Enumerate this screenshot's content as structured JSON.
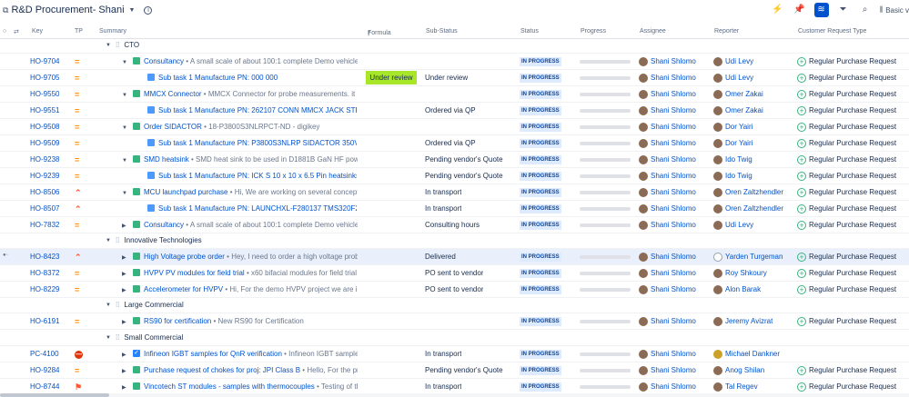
{
  "header": {
    "title": "R&D Procurement- Shani",
    "basic_view": "Basic v"
  },
  "columns": {
    "key": "Key",
    "tp": "TP",
    "summary": "Summary",
    "formula": "Formula",
    "substatus": "Sub-Status",
    "status": "Status",
    "progress": "Progress",
    "assignee": "Assignee",
    "reporter": "Reporter",
    "crt": "Customer Request Type"
  },
  "groups": {
    "cto": "CTO",
    "innovative": "Innovative Technologies",
    "large": "Large Commercial",
    "small": "Small Commercial"
  },
  "rows": [
    {
      "key": "HO-9704",
      "summary": "Consultancy",
      "desc": "A small scale of about 100:1 complete Demo vehicle el",
      "formula": "",
      "substatus": "",
      "status": "IN PROGRESS",
      "assignee": "Shani Shlomo",
      "reporter": "Udi Levy",
      "crt": "Regular Purchase Request"
    },
    {
      "key": "HO-9705",
      "summary": "Sub task 1 Manufacture PN: 000 000",
      "desc": "",
      "formula": "Under review",
      "substatus": "Under review",
      "status": "IN PROGRESS",
      "assignee": "Shani Shlomo",
      "reporter": "Udi Levy",
      "crt": "Regular Purchase Request"
    },
    {
      "key": "HO-9550",
      "summary": "MMCX Connector",
      "desc": "MMCX Connector for probe measurements. it ha",
      "formula": "",
      "substatus": "",
      "status": "IN PROGRESS",
      "assignee": "Shani Shlomo",
      "reporter": "Omer Zakai",
      "crt": "Regular Purchase Request"
    },
    {
      "key": "HO-9551",
      "summary": "Sub task 1 Manufacture PN: 262107 CONN MMCX JACK STR 50O",
      "desc": "",
      "formula": "",
      "substatus": "Ordered via QP",
      "status": "IN PROGRESS",
      "assignee": "Shani Shlomo",
      "reporter": "Omer Zakai",
      "crt": "Regular Purchase Request"
    },
    {
      "key": "HO-9508",
      "summary": "Order SIDACTOR",
      "desc": "18-P3800S3NLRPCT-ND - digikey",
      "formula": "",
      "substatus": "",
      "status": "IN PROGRESS",
      "assignee": "Shani Shlomo",
      "reporter": "Dor Yairi",
      "crt": "Regular Purchase Request"
    },
    {
      "key": "HO-9509",
      "summary": "Sub task 1 Manufacture PN: P3800S3NLRP SIDACTOR 350V 3000",
      "desc": "",
      "formula": "",
      "substatus": "Ordered via QP",
      "status": "IN PROGRESS",
      "assignee": "Shani Shlomo",
      "reporter": "Dor Yairi",
      "crt": "Regular Purchase Request"
    },
    {
      "key": "HO-9238",
      "summary": "SMD heatsink",
      "desc": "SMD heat sink to be used in D1881B GaN HF power s",
      "formula": "",
      "substatus": "Pending vendor's Quote",
      "status": "IN PROGRESS",
      "assignee": "Shani Shlomo",
      "reporter": "Ido Twig",
      "crt": "Regular Purchase Request"
    },
    {
      "key": "HO-9239",
      "summary": "Sub task 1 Manufacture PN: ICK S 10 x 10 x 6.5 Pin heatsinks rect",
      "desc": "",
      "formula": "",
      "substatus": "Pending vendor's Quote",
      "status": "IN PROGRESS",
      "assignee": "Shani Shlomo",
      "reporter": "Ido Twig",
      "crt": "Regular Purchase Request"
    },
    {
      "key": "HO-8506",
      "summary": "MCU launchpad purchase",
      "desc": "Hi, We are working on several concept de",
      "formula": "",
      "substatus": "In transport",
      "status": "IN PROGRESS",
      "assignee": "Shani Shlomo",
      "reporter": "Oren Zaltzhendler",
      "crt": "Regular Purchase Request"
    },
    {
      "key": "HO-8507",
      "summary": "Sub task 1 Manufacture PN: LAUNCHXL-F280137 TMS320F280",
      "desc": "",
      "formula": "",
      "substatus": "In transport",
      "status": "IN PROGRESS",
      "assignee": "Shani Shlomo",
      "reporter": "Oren Zaltzhendler",
      "crt": "Regular Purchase Request"
    },
    {
      "key": "HO-7832",
      "summary": "Consultancy",
      "desc": "A small scale of about 100:1 complete Demo vehicle el",
      "formula": "",
      "substatus": "Consulting hours",
      "status": "IN PROGRESS",
      "assignee": "Shani Shlomo",
      "reporter": "Udi Levy",
      "crt": "Regular Purchase Request"
    },
    {
      "key": "HO-8423",
      "summary": "High Voltage probe order",
      "desc": "Hey, I need to order a high voltage probe",
      "formula": "",
      "substatus": "Delivered",
      "status": "IN PROGRESS",
      "assignee": "Shani Shlomo",
      "reporter": "Yarden Turgeman",
      "crt": "Regular Purchase Request"
    },
    {
      "key": "HO-8372",
      "summary": "HVPV PV modules for field trial",
      "desc": "x60 bifacial modules for field trial to",
      "formula": "",
      "substatus": "PO sent to vendor",
      "status": "IN PROGRESS",
      "assignee": "Shani Shlomo",
      "reporter": "Roy Shkoury",
      "crt": "Regular Purchase Request"
    },
    {
      "key": "HO-8229",
      "summary": "Accelerometer for HVPV",
      "desc": "Hi, For the demo HVPV project we are inte",
      "formula": "",
      "substatus": "PO sent to vendor",
      "status": "IN PROGRESS",
      "assignee": "Shani Shlomo",
      "reporter": "Alon Barak",
      "crt": "Regular Purchase Request"
    },
    {
      "key": "HO-6191",
      "summary": "RS90 for certification",
      "desc": "New RS90 for Certification",
      "formula": "",
      "substatus": "",
      "status": "IN PROGRESS",
      "assignee": "Shani Shlomo",
      "reporter": "Jeremy Avizrat",
      "crt": "Regular Purchase Request"
    },
    {
      "key": "PC-4100",
      "summary": "Infineon IGBT samples for QnR verification",
      "desc": "Infineon IGBT samples fo",
      "formula": "",
      "substatus": "In transport",
      "status": "IN PROGRESS",
      "assignee": "Shani Shlomo",
      "reporter": "Michael Dankner",
      "crt": ""
    },
    {
      "key": "HO-9284",
      "summary": "Purchase request of chokes for proj: JPI Class B",
      "desc": "Hello, For the project",
      "formula": "",
      "substatus": "Pending vendor's Quote",
      "status": "IN PROGRESS",
      "assignee": "Shani Shlomo",
      "reporter": "Anog Shilan",
      "crt": "Regular Purchase Request"
    },
    {
      "key": "HO-8744",
      "summary": "Vincotech ST modules - samples with thermocouples",
      "desc": "Testing of the",
      "formula": "",
      "substatus": "In transport",
      "status": "IN PROGRESS",
      "assignee": "Shani Shlomo",
      "reporter": "Tal Regev",
      "crt": "Regular Purchase Request"
    }
  ]
}
